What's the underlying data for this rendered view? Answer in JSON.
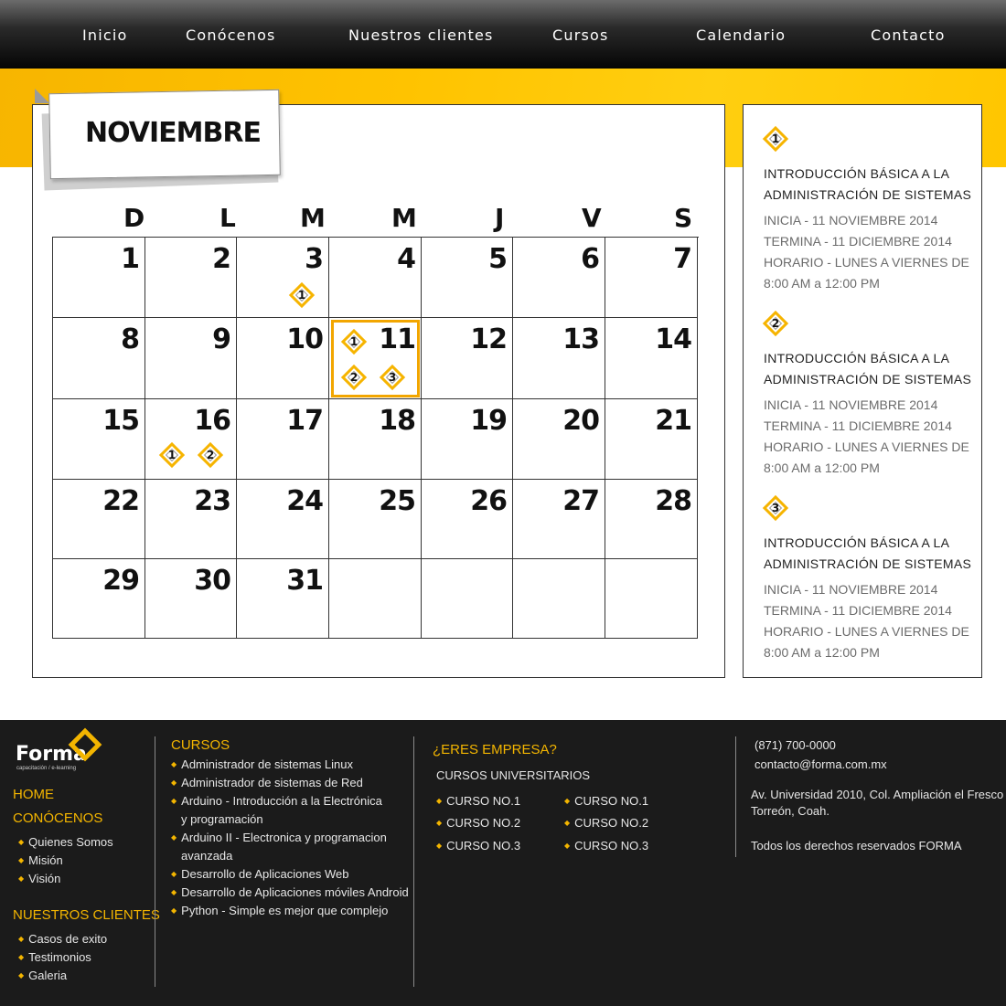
{
  "nav": {
    "items": [
      "Inicio",
      "Conócenos",
      "Nuestros clientes",
      "Cursos",
      "Calendario",
      "Contacto"
    ]
  },
  "calendar": {
    "month": "NOVIEMBRE",
    "weekdays": [
      "D",
      "L",
      "M",
      "M",
      "J",
      "V",
      "S"
    ],
    "weeks": [
      [
        1,
        2,
        3,
        4,
        5,
        6,
        7
      ],
      [
        8,
        9,
        10,
        11,
        12,
        13,
        14
      ],
      [
        15,
        16,
        17,
        18,
        19,
        20,
        21
      ],
      [
        22,
        23,
        24,
        25,
        26,
        27,
        28
      ],
      [
        29,
        30,
        31,
        null,
        null,
        null,
        null
      ]
    ],
    "highlighted_day": 11,
    "events": {
      "3": [
        "1"
      ],
      "11": [
        "1",
        "2",
        "3"
      ],
      "16": [
        "1",
        "2"
      ]
    }
  },
  "courses": [
    {
      "number": "1",
      "title_line1": "INTRODUCCIÓN BÁSICA A LA",
      "title_line2": "ADMINISTRACIÓN DE SISTEMAS",
      "start": "INICIA - 11 NOVIEMBRE 2014",
      "end": "TERMINA - 11 DICIEMBRE 2014",
      "schedule_line1": "HORARIO - LUNES A VIERNES DE",
      "schedule_line2": "8:00 AM a 12:00 PM"
    },
    {
      "number": "2",
      "title_line1": "INTRODUCCIÓN BÁSICA A LA",
      "title_line2": "ADMINISTRACIÓN DE SISTEMAS",
      "start": "INICIA - 11 NOVIEMBRE 2014",
      "end": "TERMINA - 11 DICIEMBRE 2014",
      "schedule_line1": "HORARIO - LUNES A VIERNES DE",
      "schedule_line2": "8:00 AM a 12:00 PM"
    },
    {
      "number": "3",
      "title_line1": "INTRODUCCIÓN BÁSICA A LA",
      "title_line2": "ADMINISTRACIÓN DE SISTEMAS",
      "start": "INICIA - 11 NOVIEMBRE 2014",
      "end": "TERMINA - 11 DICIEMBRE 2014",
      "schedule_line1": "HORARIO - LUNES A VIERNES DE",
      "schedule_line2": "8:00 AM a 12:00 PM"
    }
  ],
  "footer": {
    "logo": {
      "name": "Forma",
      "tagline": "capacitación / e-learning"
    },
    "col1": {
      "home": "HOME",
      "conocenos": "CONÓCENOS",
      "conocenos_items": [
        "Quienes Somos",
        "Misión",
        "Visión"
      ],
      "clientes": "NUESTROS CLIENTES",
      "clientes_items": [
        "Casos de exito",
        "Testimonios",
        "Galeria"
      ]
    },
    "col2": {
      "heading": "CURSOS",
      "items": [
        "Administrador de sistemas Linux",
        "Administrador de sistemas de Red",
        "Arduino - Introducción a la Electrónica",
        "y programación",
        "Arduino II - Electronica y programacion",
        "avanzada",
        "Desarrollo de Aplicaciones Web",
        "Desarrollo de Aplicaciones móviles Android",
        "Python - Simple es mejor que complejo"
      ]
    },
    "col3": {
      "heading": "¿ERES EMPRESA?",
      "subheading": "CURSOS UNIVERSITARIOS",
      "left": [
        "CURSO NO.1",
        "CURSO NO.2",
        "CURSO NO.3"
      ],
      "right": [
        "CURSO NO.1",
        "CURSO NO.2",
        "CURSO NO.3"
      ]
    },
    "col4": {
      "phone": "(871) 700-0000",
      "email": "contacto@forma.com.mx",
      "address_line1": "Av. Universidad 2010, Col. Ampliación el Fresco",
      "address_line2": "Torreón, Coah.",
      "rights": "Todos los derechos reservados FORMA"
    }
  },
  "colors": {
    "accent": "#f3b500",
    "nav_bg": "#000000",
    "footer_bg": "#1b1b1b"
  },
  "icons": {
    "event_marker": "diamond-icon",
    "logo_mark": "forma-logo-icon"
  }
}
